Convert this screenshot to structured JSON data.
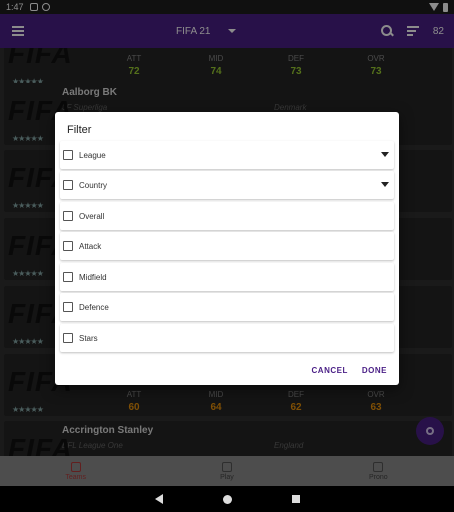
{
  "status_bar": {
    "time": "1:47"
  },
  "app_bar": {
    "version": "FIFA 21",
    "count": "82"
  },
  "teams": [
    {
      "name": "",
      "league": "",
      "country": "",
      "logo": "FIFA",
      "stars": "★★★★★",
      "att": "72",
      "mid": "74",
      "def": "73",
      "ovr": "73",
      "color": "green"
    },
    {
      "name": "Aalborg BK",
      "league": "3F Superliga",
      "country": "Denmark",
      "logo": "FIFA",
      "stars": "★★★★★"
    },
    {
      "name": "",
      "league": "",
      "country": "",
      "logo": "FIFA",
      "stars": "★★★★★"
    },
    {
      "name": "",
      "league": "",
      "country": "",
      "logo": "FIFA",
      "stars": "★★★★★"
    },
    {
      "name": "",
      "league": "",
      "country": "",
      "logo": "FIFA",
      "stars": "★★★★★"
    },
    {
      "name": "",
      "league": "",
      "country": "",
      "logo": "FIFA",
      "stars": "★★★★★",
      "att": "60",
      "mid": "64",
      "def": "62",
      "ovr": "63",
      "color": "orange"
    },
    {
      "name": "Accrington Stanley",
      "league": "EFL League One",
      "country": "England",
      "logo": "FIFA",
      "stars": ""
    }
  ],
  "stat_labels": {
    "att": "ATT",
    "mid": "MID",
    "def": "DEF",
    "ovr": "OVR"
  },
  "dialog": {
    "title": "Filter",
    "rows": [
      "League",
      "Country",
      "Overall",
      "Attack",
      "Midfield",
      "Defence",
      "Stars"
    ],
    "cancel": "CANCEL",
    "done": "DONE"
  },
  "bottom_nav": {
    "teams": "Teams",
    "play": "Play",
    "prono": "Prono"
  },
  "colors": {
    "primary": "#4a1f86",
    "green": "#9acd32",
    "orange": "#e8910a"
  }
}
